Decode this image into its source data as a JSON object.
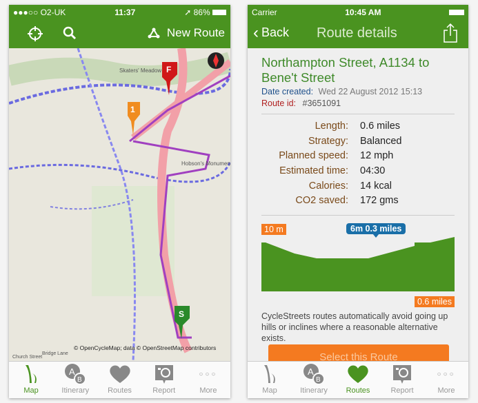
{
  "left": {
    "status": {
      "carrier": "●●●○○ O2-UK",
      "time": "11:37",
      "battery": "86%"
    },
    "nav": {
      "new_route_label": "New Route"
    },
    "map": {
      "labels": [
        "Skaters' Meadow",
        "Hobson's Monument",
        "Church Street",
        "Bridge Lane"
      ],
      "attribution": "© OpenCycleMap; data © OpenStreetMap contributors",
      "markers": {
        "finish": "F",
        "waypoint": "1",
        "start": "S"
      }
    },
    "tabs": [
      {
        "label": "Map",
        "icon": "map-icon",
        "active": true
      },
      {
        "label": "Itinerary",
        "icon": "itinerary-ab-icon"
      },
      {
        "label": "Routes",
        "icon": "heart-icon"
      },
      {
        "label": "Report",
        "icon": "camera-report-icon"
      },
      {
        "label": "More",
        "icon": "more-dots-icon"
      }
    ]
  },
  "right": {
    "status": {
      "carrier": "Carrier",
      "time": "10:45 AM"
    },
    "nav": {
      "back_label": "Back",
      "title": "Route details"
    },
    "route": {
      "title": "Northampton Street, A1134 to Bene't Street",
      "date_label": "Date created:",
      "date_value": "Wed 22 August 2012 15:13",
      "id_label": "Route id:",
      "id_value": "#3651091"
    },
    "stats": [
      {
        "label": "Length:",
        "value": "0.6 miles"
      },
      {
        "label": "Strategy:",
        "value": "Balanced"
      },
      {
        "label": "Planned speed:",
        "value": "12 mph"
      },
      {
        "label": "Estimated time:",
        "value": "04:30"
      },
      {
        "label": "Calories:",
        "value": "14 kcal"
      },
      {
        "label": "CO2 saved:",
        "value": "172 gms"
      }
    ],
    "elevation": {
      "max_label": "10 m",
      "tooltip": "6m 0.3 miles",
      "distance_label": "0.6 miles"
    },
    "note": "CycleStreets routes automatically avoid going up hills or inclines where a reasonable alternative exists.",
    "select_button": "Select this Route",
    "tabs": [
      {
        "label": "Map",
        "icon": "map-icon"
      },
      {
        "label": "Itinerary",
        "icon": "itinerary-ab-icon"
      },
      {
        "label": "Routes",
        "icon": "heart-icon",
        "active": true
      },
      {
        "label": "Report",
        "icon": "camera-report-icon"
      },
      {
        "label": "More",
        "icon": "more-dots-icon"
      }
    ]
  },
  "colors": {
    "brand_green": "#4a9320",
    "orange": "#f47a20",
    "tooltip_blue": "#1a6fa8"
  }
}
